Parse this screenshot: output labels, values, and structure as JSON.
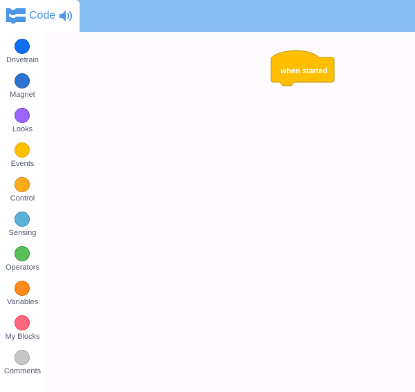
{
  "header": {
    "tab_label": "Code",
    "icons": [
      "blocks-icon",
      "speaker-icon"
    ]
  },
  "sidebar": {
    "categories": [
      {
        "label": "Drivetrain",
        "color": "#0f6ff0",
        "border": "#0b5ac8"
      },
      {
        "label": "Magnet",
        "color": "#2d74cf",
        "border": "#245fa8"
      },
      {
        "label": "Looks",
        "color": "#9966ff",
        "border": "#774dcb"
      },
      {
        "label": "Events",
        "color": "#ffbf00",
        "border": "#e6a800"
      },
      {
        "label": "Control",
        "color": "#ffab19",
        "border": "#cf8b17"
      },
      {
        "label": "Sensing",
        "color": "#5cb1d6",
        "border": "#2e8eb8"
      },
      {
        "label": "Operators",
        "color": "#59c059",
        "border": "#389438"
      },
      {
        "label": "Variables",
        "color": "#ff8c1a",
        "border": "#db6e00"
      },
      {
        "label": "My Blocks",
        "color": "#ff6680",
        "border": "#ff3355"
      },
      {
        "label": "Comments",
        "color": "#c6c6c6",
        "border": "#a9a9a9"
      }
    ]
  },
  "workspace": {
    "hat_block": {
      "label": "when started",
      "color": "#ffbf00",
      "border": "#cc9900"
    }
  },
  "colors": {
    "topbar": "#87bdf2",
    "accent": "#4c97e6",
    "label_text": "#575e75"
  }
}
